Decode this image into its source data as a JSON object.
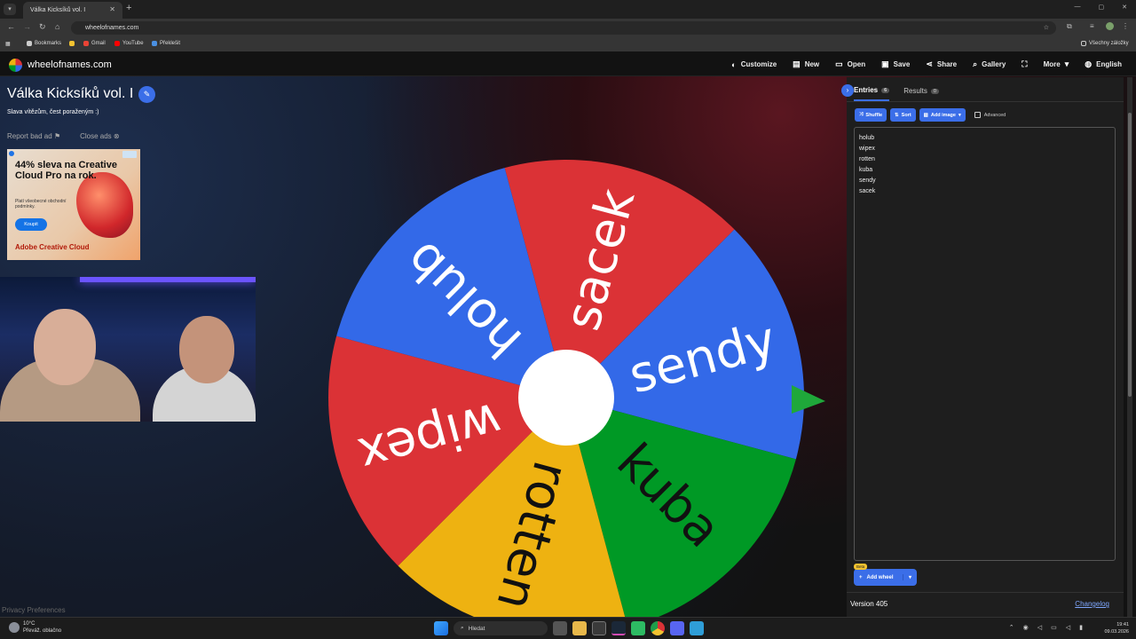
{
  "browser": {
    "tab_title": "Válka Kicksíků vol. I",
    "url": "wheelofnames.com",
    "bookmarks": [
      {
        "label": "Bookmarks"
      },
      {
        "label": "Gmail"
      },
      {
        "label": "YouTube"
      },
      {
        "label": "Překlešit"
      }
    ],
    "all_bookmarks": "Všechny záložky"
  },
  "app": {
    "brand": "wheelofnames.com",
    "menu": [
      {
        "label": "Customize",
        "icon": "palette-icon"
      },
      {
        "label": "New",
        "icon": "file-icon"
      },
      {
        "label": "Open",
        "icon": "folder-icon"
      },
      {
        "label": "Save",
        "icon": "save-icon"
      },
      {
        "label": "Share",
        "icon": "share-icon"
      },
      {
        "label": "Gallery",
        "icon": "search-icon"
      },
      {
        "label": "More",
        "icon": "chevron-down-icon"
      },
      {
        "label": "English",
        "icon": "globe-icon"
      }
    ],
    "title": "Válka Kicksíků vol. I",
    "subtitle": "Slava vítězům, čest poraženým :)",
    "report_bad_ad": "Report bad ad",
    "close_ads": "Close ads",
    "privacy": "Privacy Preferences"
  },
  "ad": {
    "headline": "44% sleva na Creative Cloud Pro na rok.",
    "fine_print": "Platí všeobecné obchodní podmínky.",
    "button": "Koupit",
    "brand": "Adobe Creative Cloud"
  },
  "wheel": {
    "segments": [
      {
        "label": "sacek",
        "color": "#db3236"
      },
      {
        "label": "sendy",
        "color": "#3369e8"
      },
      {
        "label": "kuba",
        "color": "#009925"
      },
      {
        "label": "rotten",
        "color": "#eeb211"
      },
      {
        "label": "wipex",
        "color": "#db3236"
      },
      {
        "label": "holub",
        "color": "#3369e8"
      }
    ],
    "pointer_color": "#1fa83a"
  },
  "sidebar": {
    "tabs": [
      {
        "label": "Entries",
        "count": "6"
      },
      {
        "label": "Results",
        "count": "0"
      }
    ],
    "toolbar": {
      "shuffle": "Shuffle",
      "sort": "Sort",
      "add_image": "Add image",
      "advanced": "Advanced"
    },
    "entries": [
      "holub",
      "wipex",
      "rotten",
      "kuba",
      "sendy",
      "sacek"
    ],
    "beta": "Beta",
    "add_wheel": "Add wheel",
    "version": "Version 405",
    "changelog": "Changelog"
  },
  "taskbar": {
    "temperature": "10°C",
    "weather": "Převáž. oblačno",
    "search": "Hledat",
    "time": "19:41",
    "date": "09.03.2026"
  }
}
